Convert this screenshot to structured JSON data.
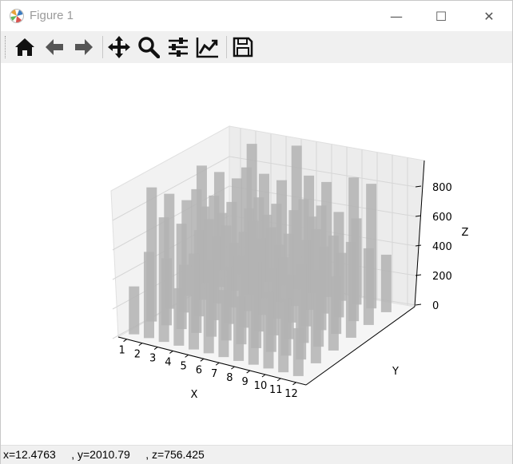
{
  "window": {
    "title": "Figure 1",
    "controls": {
      "minimize": "—",
      "maximize": "☐",
      "close": "✕"
    }
  },
  "toolbar": {
    "tools": [
      "home-icon",
      "back-arrow-icon",
      "forward-arrow-icon",
      "pan-icon",
      "zoom-icon",
      "subplots-icon",
      "edit-axes-icon",
      "save-icon"
    ]
  },
  "status": {
    "text": "x=12.4763     , y=2010.79     , z=756.425"
  },
  "colors": {
    "bar": "#b3b3b3",
    "pane": "#f2f2f2",
    "toolbar": "#f0f0f0"
  },
  "chart_data": {
    "type": "bar3d",
    "title": "",
    "xlabel": "X",
    "ylabel": "Y",
    "zlabel": "Z",
    "x_ticks": [
      "1",
      "2",
      "3",
      "4",
      "5",
      "6",
      "7",
      "8",
      "9",
      "10",
      "11",
      "12"
    ],
    "z_ticks": [
      "0",
      "200",
      "400",
      "600",
      "800"
    ],
    "zlim": [
      0,
      900
    ],
    "grid": true
  }
}
